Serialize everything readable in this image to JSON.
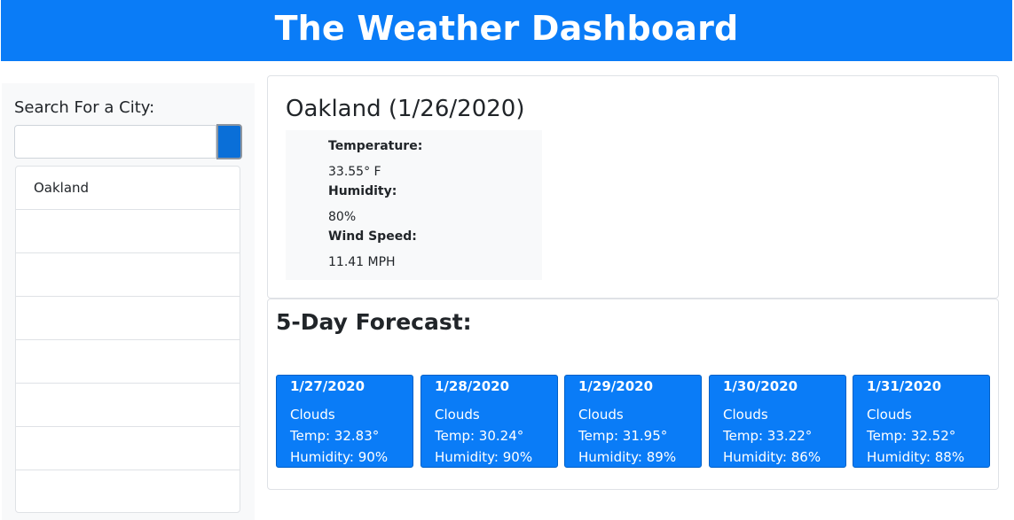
{
  "header": {
    "title": "The Weather Dashboard"
  },
  "sidebar": {
    "search_label": "Search For a City:",
    "search_value": "",
    "history": [
      "Oakland",
      "",
      "",
      "",
      "",
      "",
      "",
      ""
    ]
  },
  "current": {
    "title": "Oakland (1/26/2020)",
    "temperature_label": "Temperature:",
    "temperature_value": "33.55° F",
    "humidity_label": "Humidity:",
    "humidity_value": "80%",
    "wind_label": "Wind Speed:",
    "wind_value": "11.41 MPH"
  },
  "forecast": {
    "title": "5-Day Forecast:",
    "days": [
      {
        "date": "1/27/2020",
        "condition": "Clouds",
        "temp": "Temp: 32.83°",
        "humidity": "Humidity: 90%"
      },
      {
        "date": "1/28/2020",
        "condition": "Clouds",
        "temp": "Temp: 30.24°",
        "humidity": "Humidity: 90%"
      },
      {
        "date": "1/29/2020",
        "condition": "Clouds",
        "temp": "Temp: 31.95°",
        "humidity": "Humidity: 89%"
      },
      {
        "date": "1/30/2020",
        "condition": "Clouds",
        "temp": "Temp: 33.22°",
        "humidity": "Humidity: 86%"
      },
      {
        "date": "1/31/2020",
        "condition": "Clouds",
        "temp": "Temp: 32.52°",
        "humidity": "Humidity: 88%"
      }
    ]
  },
  "colors": {
    "accent": "#0a7cf7",
    "panel": "#f8f9fa",
    "border": "#dfe2e6"
  }
}
